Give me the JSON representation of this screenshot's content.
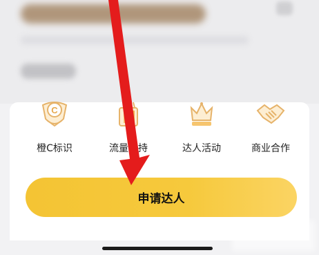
{
  "features": [
    {
      "label": "橙C标识",
      "icon": "badge-c-icon"
    },
    {
      "label": "流量扶持",
      "icon": "traffic-boost-icon"
    },
    {
      "label": "达人活动",
      "icon": "crown-icon"
    },
    {
      "label": "商业合作",
      "icon": "handshake-icon"
    }
  ],
  "apply_button": {
    "label": "申请达人"
  },
  "colors": {
    "accent": "#f5c53a",
    "icon_gold": "#e8b86a",
    "annotation_arrow": "#e41c1c"
  }
}
